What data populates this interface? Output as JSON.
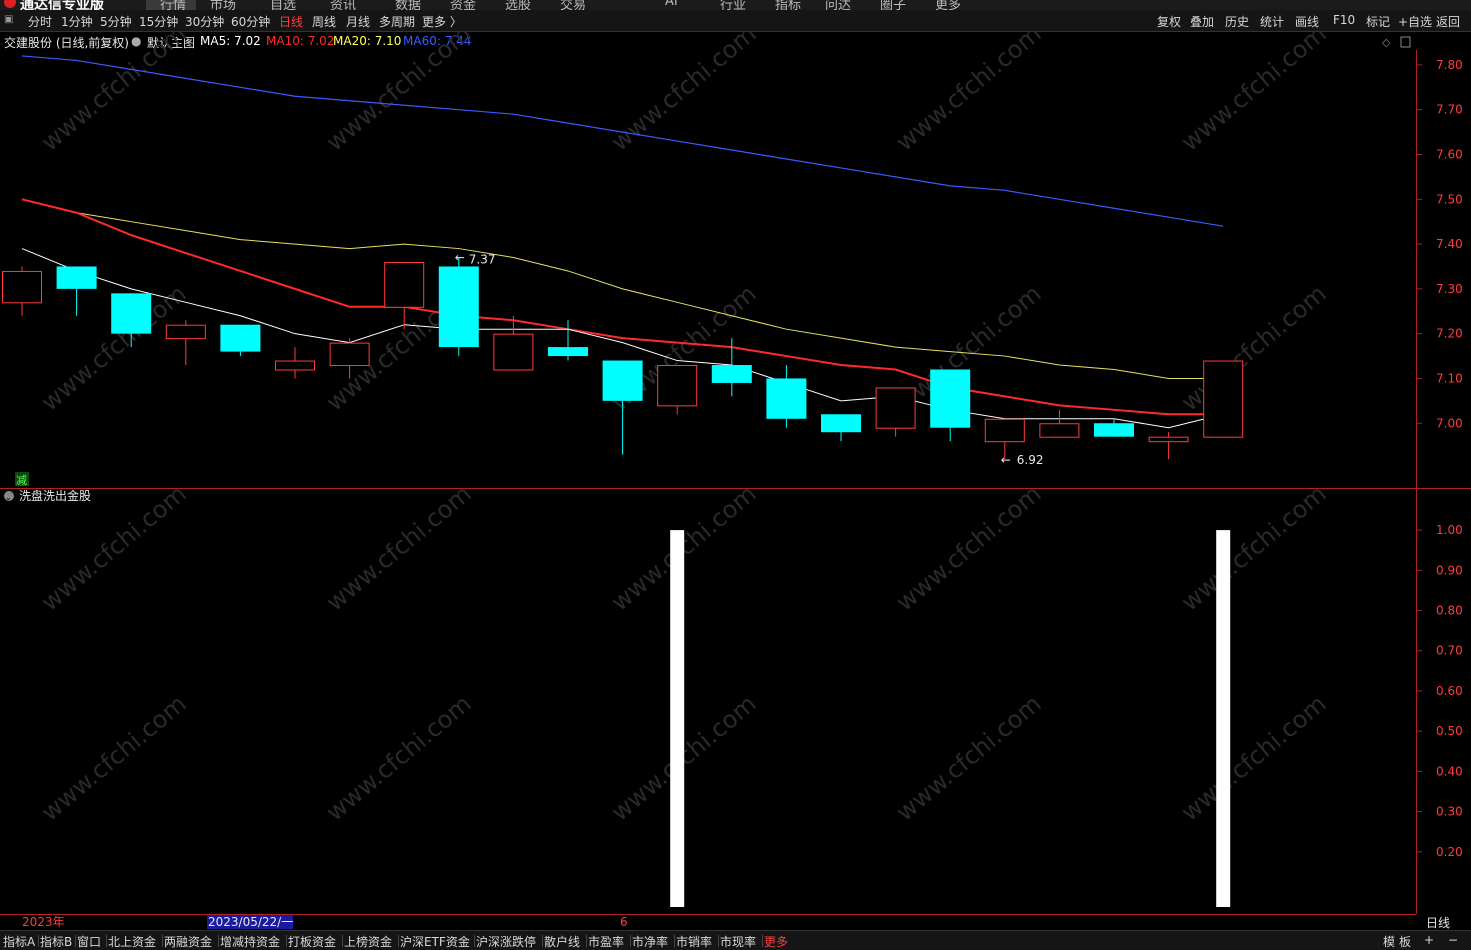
{
  "header": {
    "brand": "通达信专业版",
    "menu": [
      "行情",
      "市场",
      "自选",
      "资讯",
      "数据",
      "资金",
      "选股",
      "交易",
      "AI",
      "行业",
      "指标",
      "问达",
      "圈子",
      "更多"
    ]
  },
  "toolbar": {
    "periods": [
      {
        "label": "分时",
        "active": false
      },
      {
        "label": "1分钟",
        "active": false
      },
      {
        "label": "5分钟",
        "active": false
      },
      {
        "label": "15分钟",
        "active": false
      },
      {
        "label": "30分钟",
        "active": false
      },
      {
        "label": "60分钟",
        "active": false
      },
      {
        "label": "日线",
        "active": true
      },
      {
        "label": "周线",
        "active": false
      },
      {
        "label": "月线",
        "active": false
      },
      {
        "label": "多周期",
        "active": false
      },
      {
        "label": "更多 〉",
        "active": false
      }
    ],
    "right_actions": [
      "复权",
      "叠加",
      "历史",
      "统计",
      "画线",
      "F10",
      "标记",
      "+自选",
      "返回"
    ]
  },
  "main_chart": {
    "title": "交建股份 (日线,前复权)",
    "template": "默认主图",
    "ma": [
      {
        "label": "MA5: 7.02",
        "color": "#ffffff"
      },
      {
        "label": "MA10: 7.02",
        "color": "#ff2a2a"
      },
      {
        "label": "MA20: 7.10",
        "color": "#ffff55"
      },
      {
        "label": "MA60: 7.44",
        "color": "#3b5bff"
      }
    ],
    "high_label": "7.37",
    "low_label": "6.92",
    "marker": "减",
    "y_ticks": [
      "7.80",
      "7.70",
      "7.60",
      "7.50",
      "7.40",
      "7.30",
      "7.20",
      "7.10",
      "7.00"
    ]
  },
  "sub_chart": {
    "title": "洗盘洗出金股",
    "y_ticks": [
      "1.00",
      "0.90",
      "0.80",
      "0.70",
      "0.60",
      "0.50",
      "0.40",
      "0.30",
      "0.20"
    ]
  },
  "time_axis": {
    "year": "2023年",
    "cursor_date": "2023/05/22/一",
    "month": "6",
    "period": "日线"
  },
  "chart_data": {
    "type": "candlestick",
    "title": "交建股份 (日线,前复权)",
    "ylim": [
      6.88,
      7.84
    ],
    "candles": [
      {
        "o": 7.27,
        "c": 7.34,
        "h": 7.35,
        "l": 7.24
      },
      {
        "o": 7.35,
        "c": 7.3,
        "h": 7.35,
        "l": 7.24
      },
      {
        "o": 7.29,
        "c": 7.2,
        "h": 7.29,
        "l": 7.17
      },
      {
        "o": 7.19,
        "c": 7.22,
        "h": 7.23,
        "l": 7.13
      },
      {
        "o": 7.22,
        "c": 7.16,
        "h": 7.22,
        "l": 7.15
      },
      {
        "o": 7.12,
        "c": 7.14,
        "h": 7.17,
        "l": 7.1
      },
      {
        "o": 7.13,
        "c": 7.18,
        "h": 7.19,
        "l": 7.1
      },
      {
        "o": 7.26,
        "c": 7.36,
        "h": 7.36,
        "l": 7.21
      },
      {
        "o": 7.35,
        "c": 7.17,
        "h": 7.37,
        "l": 7.15
      },
      {
        "o": 7.12,
        "c": 7.2,
        "h": 7.24,
        "l": 7.12
      },
      {
        "o": 7.17,
        "c": 7.15,
        "h": 7.23,
        "l": 7.14
      },
      {
        "o": 7.14,
        "c": 7.05,
        "h": 7.14,
        "l": 6.93
      },
      {
        "o": 7.04,
        "c": 7.13,
        "h": 7.13,
        "l": 7.02
      },
      {
        "o": 7.13,
        "c": 7.09,
        "h": 7.19,
        "l": 7.06
      },
      {
        "o": 7.1,
        "c": 7.01,
        "h": 7.13,
        "l": 6.99
      },
      {
        "o": 7.02,
        "c": 6.98,
        "h": 7.02,
        "l": 6.96
      },
      {
        "o": 6.99,
        "c": 7.08,
        "h": 7.08,
        "l": 6.97
      },
      {
        "o": 7.12,
        "c": 6.99,
        "h": 7.12,
        "l": 6.96
      },
      {
        "o": 6.96,
        "c": 7.01,
        "h": 7.01,
        "l": 6.92
      },
      {
        "o": 6.97,
        "c": 7.0,
        "h": 7.03,
        "l": 6.97
      },
      {
        "o": 7.0,
        "c": 6.97,
        "h": 7.01,
        "l": 6.97
      },
      {
        "o": 6.96,
        "c": 6.97,
        "h": 6.98,
        "l": 6.92
      },
      {
        "o": 6.97,
        "c": 7.14,
        "h": 7.14,
        "l": 6.97
      }
    ],
    "ma5": [
      7.39,
      7.34,
      7.3,
      7.27,
      7.24,
      7.2,
      7.18,
      7.22,
      7.21,
      7.21,
      7.21,
      7.18,
      7.14,
      7.13,
      7.09,
      7.05,
      7.06,
      7.03,
      7.01,
      7.01,
      7.01,
      6.99,
      7.02
    ],
    "ma10": [
      7.5,
      7.47,
      7.42,
      7.38,
      7.34,
      7.3,
      7.26,
      7.26,
      7.24,
      7.23,
      7.21,
      7.19,
      7.18,
      7.17,
      7.15,
      7.13,
      7.12,
      7.08,
      7.06,
      7.04,
      7.03,
      7.02,
      7.02
    ],
    "ma20": [
      7.5,
      7.47,
      7.45,
      7.43,
      7.41,
      7.4,
      7.39,
      7.4,
      7.39,
      7.37,
      7.34,
      7.3,
      7.27,
      7.24,
      7.21,
      7.19,
      7.17,
      7.16,
      7.15,
      7.13,
      7.12,
      7.1,
      7.1
    ],
    "ma60": [
      7.82,
      7.81,
      7.79,
      7.77,
      7.75,
      7.73,
      7.72,
      7.71,
      7.7,
      7.69,
      7.67,
      7.65,
      7.63,
      7.61,
      7.59,
      7.57,
      7.55,
      7.53,
      7.52,
      7.5,
      7.48,
      7.46,
      7.44
    ],
    "signal": [
      0,
      0,
      0,
      0,
      0,
      0,
      0,
      0,
      0,
      0,
      0,
      0,
      1,
      0,
      0,
      0,
      0,
      0,
      0,
      0,
      0,
      0,
      1
    ],
    "signal_ylim": [
      0.1,
      1.05
    ]
  },
  "bottom_tabs": [
    "指标A",
    "指标B",
    "窗口",
    "北上资金",
    "两融资金",
    "增减持资金",
    "打板资金",
    "上榜资金",
    "沪深ETF资金",
    "沪深涨跌停",
    "散户线",
    "市盈率",
    "市净率",
    "市销率",
    "市现率",
    "更多"
  ],
  "bottom_right": [
    "模",
    "板",
    "+",
    "−"
  ],
  "watermark": "www.cfchi.com"
}
